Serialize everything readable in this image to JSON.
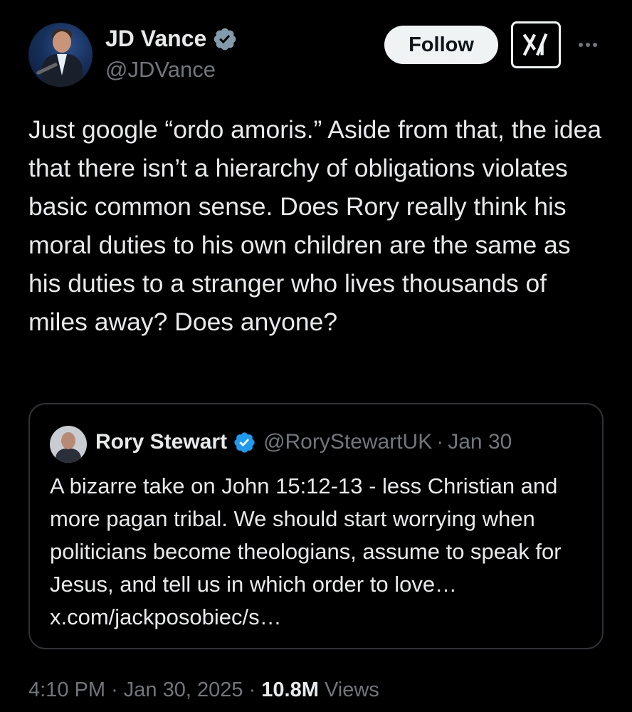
{
  "author": {
    "name": "JD Vance",
    "handle": "@JDVance",
    "avatar_icon": "profile-photo",
    "verified_icon": "verified-badge-icon",
    "verified_color": "#829aab"
  },
  "actions": {
    "follow_label": "Follow",
    "grok_icon": "grok-icon",
    "more_icon": "more-options-icon"
  },
  "tweet": {
    "text": "Just google “ordo amoris.” Aside from that, the idea that there isn’t a hierarchy of obligations violates basic common sense. Does Rory really think his moral duties to his own children are the same as his duties to a stranger who lives thousands of miles away? Does anyone?"
  },
  "quote": {
    "name": "Rory Stewart",
    "handle": "@RoryStewartUK",
    "separator": "·",
    "date": "Jan 30",
    "verified_color": "#1d9bf0",
    "text": "A bizarre take on John 15:12-13  - less Christian and more pagan tribal. We should start worrying when politicians become theologians, assume to speak for Jesus, and tell us in which order to love… x.com/jackposobiec/s…"
  },
  "meta": {
    "time": "4:10 PM",
    "sep1": "·",
    "date": "Jan 30, 2025",
    "sep2": "·",
    "views_count": "10.8M",
    "views_label": "Views"
  }
}
